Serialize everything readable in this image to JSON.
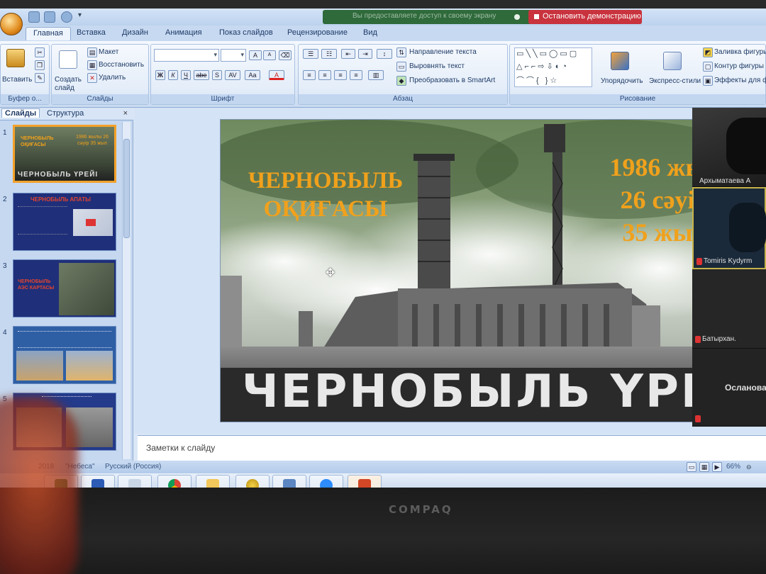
{
  "window": {
    "share_message": "Вы предоставляете доступ к своему экрану",
    "stop_share": "Остановить демонстрацию"
  },
  "ribbon_tabs": [
    "Главная",
    "Вставка",
    "Дизайн",
    "Анимация",
    "Показ слайдов",
    "Рецензирование",
    "Вид"
  ],
  "ribbon": {
    "clipboard": {
      "paste": "Вставить",
      "label": "Буфер о..."
    },
    "slides": {
      "new_slide": "Создать слайд",
      "layout": "Макет",
      "reset": "Восстановить",
      "delete": "Удалить",
      "label": "Слайды"
    },
    "font": {
      "bold": "Ж",
      "italic": "К",
      "underline": "Ч",
      "strike": "abe",
      "shadow": "S",
      "spacing": "AV",
      "case": "Aa",
      "color": "A",
      "grow": "A",
      "shrink": "A",
      "label": "Шрифт"
    },
    "paragraph": {
      "text_direction": "Направление текста",
      "align_text": "Выровнять текст",
      "smartart": "Преобразовать в SmartArt",
      "label": "Абзац"
    },
    "drawing": {
      "arrange": "Упорядочить",
      "quick_styles": "Экспресс-стили",
      "fill": "Заливка фигуры",
      "outline": "Контур фигуры",
      "effects": "Эффекты для фи...",
      "label": "Рисование"
    }
  },
  "pane": {
    "tab_slides": "Слайды",
    "tab_outline": "Структура",
    "close": "×"
  },
  "thumbnails": [
    {
      "num": "1",
      "title": "ЧЕРНОБЫЛЬ ОҚИҒАСЫ",
      "date": "1986 жылы 26 сәуір 35 жыл",
      "bottom": "ЧЕРНОБЫЛЬ ҮРЕЙІ"
    },
    {
      "num": "2",
      "title": "ЧЕРНОБЫЛЬ АПАТЫ"
    },
    {
      "num": "3",
      "title": "ЧЕРНОБЫЛЬ АЭС КАРТАСЫ"
    },
    {
      "num": "4"
    },
    {
      "num": "5"
    }
  ],
  "slide": {
    "title_line1": "ЧЕРНОБЫЛЬ",
    "title_line2": "ОҚИҒАСЫ",
    "date_line1": "1986 жы",
    "date_line2": "26 сәуі",
    "date_line3": "35 жы",
    "bottom_text": "ЧЕРНОБЫЛЬ ҮРЕЙ",
    "colors": {
      "title": "#f0a11c",
      "bottom": "#e8e8e8"
    }
  },
  "notes_placeholder": "Заметки к слайду",
  "participants": [
    {
      "name": "Архыматаева А"
    },
    {
      "name": "Tomiris Kydyrm"
    },
    {
      "name": "Батырхан."
    },
    {
      "name": "Осланова"
    }
  ],
  "status": {
    "slide_info": "2018",
    "theme": "\"Небеса\"",
    "language": "Русский (Россия)",
    "zoom": "66%"
  },
  "taskbar": [
    "excel",
    "word",
    "explorer",
    "chrome",
    "folder",
    "emblem",
    "media",
    "zoom",
    "powerpoint"
  ],
  "bezel": {
    "brand": "COMPAQ"
  }
}
